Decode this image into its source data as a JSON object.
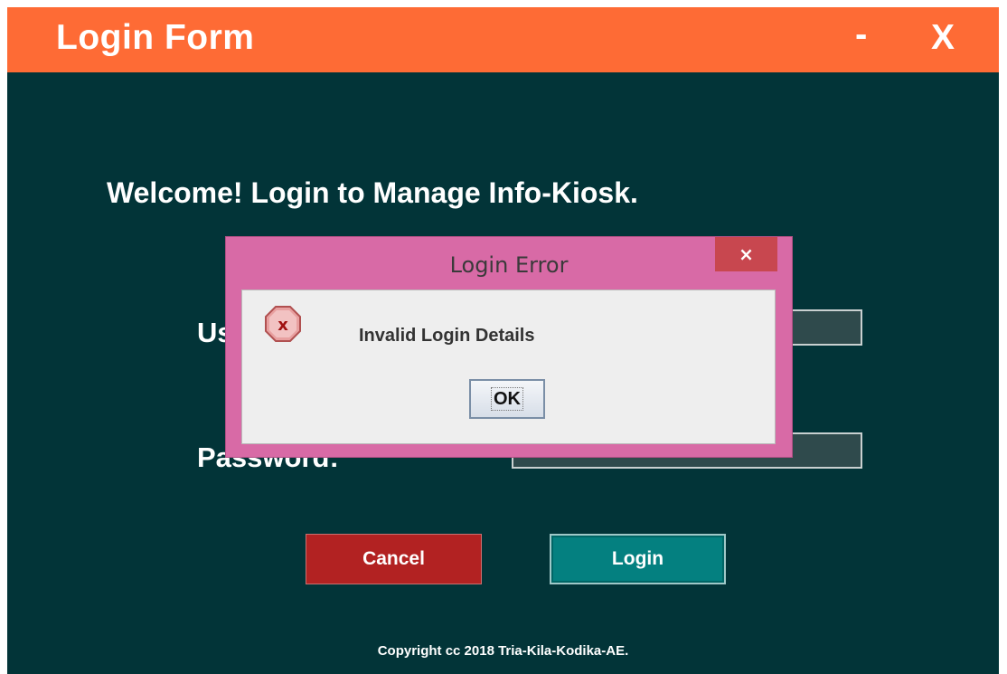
{
  "window": {
    "title": "Login Form",
    "minimize_label": "-",
    "close_label": "X"
  },
  "form": {
    "welcome_text": "Welcome! Login to Manage Info-Kiosk.",
    "username_label": "Username:",
    "password_label": "Password:",
    "cancel_label": "Cancel",
    "login_label": "Login",
    "copyright": "Copyright cc 2018 Tria-Kila-Kodika-AE."
  },
  "dialog": {
    "title": "Login Error",
    "close_label": "×",
    "message": "Invalid Login Details",
    "ok_label": "OK",
    "icon": "error-icon"
  },
  "colors": {
    "titlebar": "#fe6b35",
    "background": "#023438",
    "cancel_button": "#b22222",
    "login_button": "#048080",
    "dialog_frame": "#d86aa6",
    "dialog_close": "#c8474f"
  }
}
